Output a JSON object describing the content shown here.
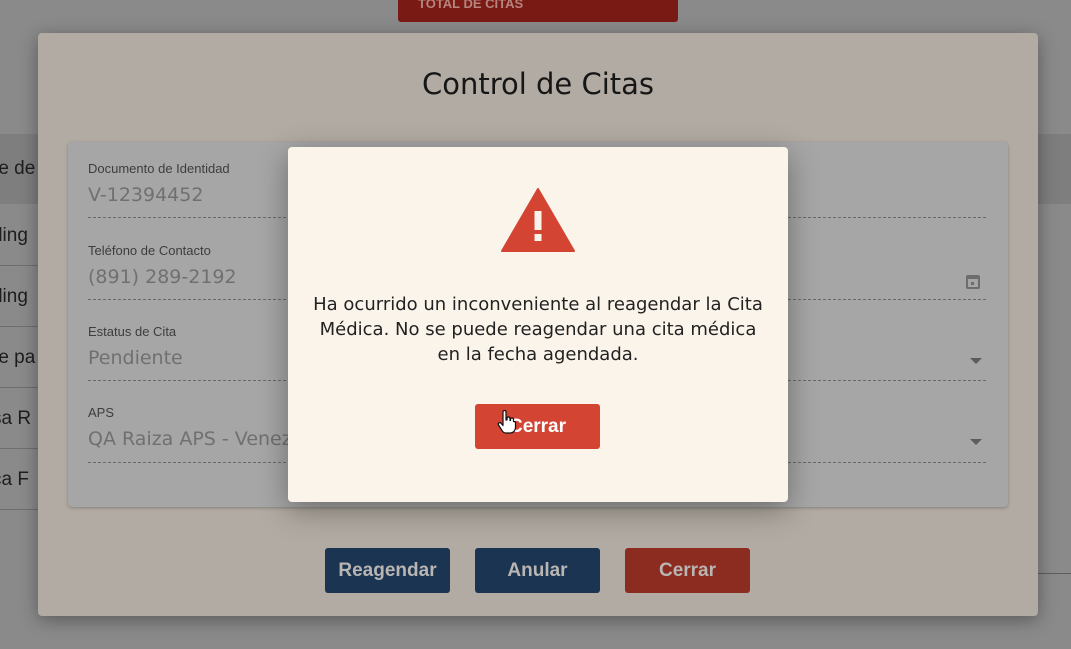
{
  "background": {
    "top_tab_label": "TOTAL DE CITAS",
    "row_fragments": [
      "re de",
      "rling",
      "rling",
      "re pa",
      "sa R",
      "ca F"
    ]
  },
  "modal": {
    "title": "Control de Citas",
    "fields": {
      "document": {
        "label": "Documento de Identidad",
        "value": "V-12394452"
      },
      "phone": {
        "label": "Teléfono de Contacto",
        "value": "(891) 289-2192"
      },
      "status": {
        "label": "Estatus de Cita",
        "value": "Pendiente"
      },
      "aps": {
        "label": "APS",
        "value": "QA Raiza APS - Venezu"
      }
    },
    "buttons": {
      "reschedule": "Reagendar",
      "cancel": "Anular",
      "close": "Cerrar"
    }
  },
  "alert": {
    "icon": "warning-triangle-icon",
    "message": "Ha ocurrido un inconveniente al reagendar la Cita Médica. No se puede reagendar una cita médica en la fecha agendada.",
    "close_label": "Cerrar",
    "accent_color": "#d44433"
  }
}
